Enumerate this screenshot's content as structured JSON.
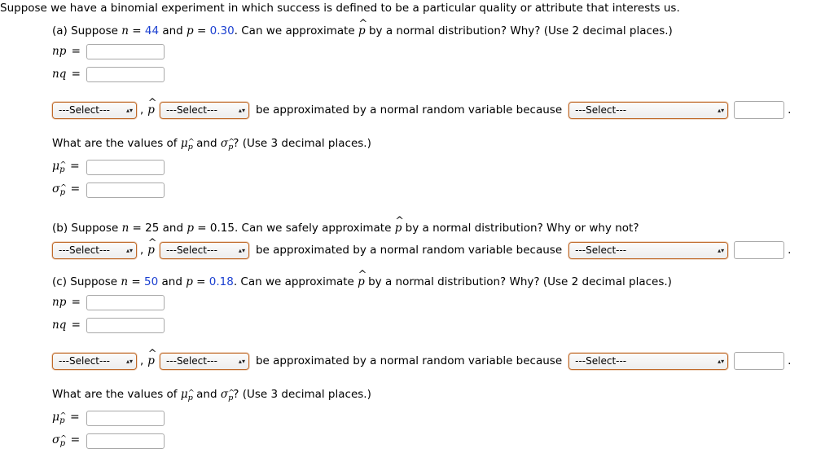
{
  "intro": "Suppose we have a binomial experiment in which success is defined to be a particular quality or attribute that interests us.",
  "select_placeholder": "---Select---",
  "arrows_glyph": "▴▾",
  "connector_comma": ",",
  "phat_symbol": "p",
  "because_text": "be approximated by a normal random variable because",
  "period": ".",
  "parts": [
    {
      "id": "a",
      "question_prefix": "(a) Suppose ",
      "n_label": "n",
      "n_eq": " = ",
      "n_value": "44",
      "mid_text": " and ",
      "p_label": "p",
      "p_eq": " = ",
      "p_value": "0.30",
      "question_suffix": ". Can we approximate p̂ by a normal distribution? Why? (Use 2 decimal places.)",
      "fields": [
        {
          "label": "np",
          "value": ""
        },
        {
          "label": "nq",
          "value": ""
        }
      ],
      "sub_question": "What are the values of μp̂ and σp̂? (Use 3 decimal places.)",
      "mu_label": "μ",
      "sigma_label": "σ",
      "stat_fields": [
        {
          "label": "mu-phat",
          "value": ""
        },
        {
          "label": "sigma-phat",
          "value": ""
        }
      ]
    },
    {
      "id": "b",
      "question_prefix": "(b) Suppose ",
      "n_label": "n",
      "n_eq": " = ",
      "n_value": "25",
      "mid_text": " and ",
      "p_label": "p",
      "p_eq": " = ",
      "p_value": "0.15",
      "question_suffix": ". Can we safely approximate p̂ by a normal distribution? Why or why not?"
    },
    {
      "id": "c",
      "question_prefix": "(c) Suppose ",
      "n_label": "n",
      "n_eq": " = ",
      "n_value": "50",
      "mid_text": " and ",
      "p_label": "p",
      "p_eq": " = ",
      "p_value": "0.18",
      "question_suffix": ". Can we approximate p̂ by a normal distribution? Why? (Use 2 decimal places.)",
      "fields": [
        {
          "label": "np",
          "value": ""
        },
        {
          "label": "nq",
          "value": ""
        }
      ],
      "sub_question": "What are the values of μp̂ and σp̂? (Use 3 decimal places.)",
      "mu_label": "μ",
      "sigma_label": "σ",
      "stat_fields": [
        {
          "label": "mu-phat",
          "value": ""
        },
        {
          "label": "sigma-phat",
          "value": ""
        }
      ]
    }
  ],
  "text": {
    "question_a_prefix": "(a) Suppose ",
    "question_a_tail": ". Can we approximate ",
    "question_a_tail2": " by a normal distribution? Why? (Use 2 decimal places.)",
    "question_b_tail": ". Can we safely approximate ",
    "question_b_tail2": " by a normal distribution? Why or why not?",
    "question_c_tail2": " by a normal distribution? Why? (Use 2 decimal places.)",
    "what_are_values_1": "What are the values of ",
    "what_are_values_2": " and ",
    "what_are_values_3": "? (Use 3 decimal places.)",
    "np_label": "np",
    "nq_label": "nq",
    "equals": " = "
  },
  "colors": {
    "blue_number": "#1a3fd0",
    "select_border": "#c06a2a",
    "input_border": "#a9a9a9"
  }
}
